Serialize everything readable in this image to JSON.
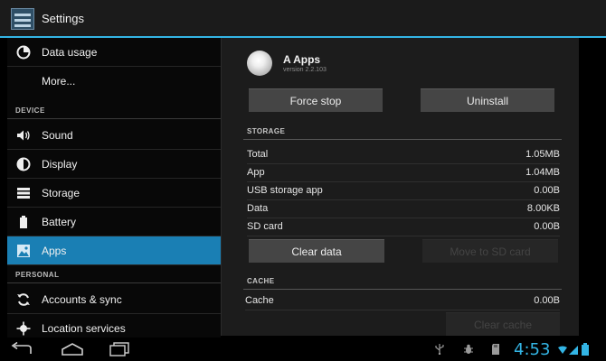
{
  "action_bar": {
    "title": "Settings"
  },
  "sidebar": {
    "items": [
      {
        "label": "Data usage"
      },
      {
        "label": "More..."
      }
    ],
    "section_device": "DEVICE",
    "device_items": [
      {
        "label": "Sound"
      },
      {
        "label": "Display"
      },
      {
        "label": "Storage"
      },
      {
        "label": "Battery"
      },
      {
        "label": "Apps",
        "selected": true
      }
    ],
    "section_personal": "PERSONAL",
    "personal_items": [
      {
        "label": "Accounts & sync"
      },
      {
        "label": "Location services"
      }
    ]
  },
  "app": {
    "name": "A Apps",
    "version": "version 2.2.103",
    "force_stop": "Force stop",
    "uninstall": "Uninstall"
  },
  "storage": {
    "title": "STORAGE",
    "rows": [
      {
        "label": "Total",
        "value": "1.05MB"
      },
      {
        "label": "App",
        "value": "1.04MB"
      },
      {
        "label": "USB storage app",
        "value": "0.00B"
      },
      {
        "label": "Data",
        "value": "8.00KB"
      },
      {
        "label": "SD card",
        "value": "0.00B"
      }
    ],
    "clear_data": "Clear data",
    "move_to_sd": "Move to SD card"
  },
  "cache": {
    "title": "CACHE",
    "rows": [
      {
        "label": "Cache",
        "value": "0.00B"
      }
    ],
    "clear_cache": "Clear cache"
  },
  "status_bar": {
    "time": "4:53"
  },
  "colors": {
    "accent": "#33b5e5",
    "selected": "#1a7fb4"
  }
}
